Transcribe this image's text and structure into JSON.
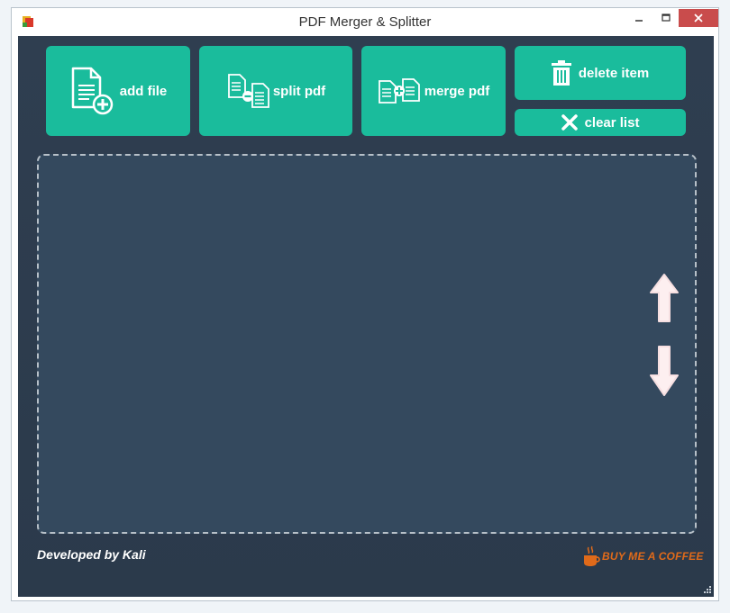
{
  "window": {
    "title": "PDF Merger & Splitter",
    "icons": {
      "app": "pdf-app-icon",
      "minimize": "minimize-icon",
      "maximize": "maximize-icon",
      "close": "close-icon"
    }
  },
  "toolbar": {
    "add_file": {
      "label": "add file",
      "icon": "file-add-icon"
    },
    "split_pdf": {
      "label": "split pdf",
      "icon": "split-files-icon"
    },
    "merge_pdf": {
      "label": "merge pdf",
      "icon": "merge-files-icon"
    },
    "delete_item": {
      "label": "delete item",
      "icon": "trash-icon"
    },
    "clear_list": {
      "label": "clear list",
      "icon": "x-cross-icon"
    }
  },
  "list": {
    "items": [],
    "move_up_icon": "arrow-up-icon",
    "move_down_icon": "arrow-down-icon"
  },
  "footer": {
    "credit": "Developed by Kali",
    "coffee_label": "BUY ME A COFFEE",
    "coffee_icon": "coffee-cup-icon"
  },
  "colors": {
    "accent": "#1abc9c",
    "background": "#2c3e50",
    "list_bg": "#34495e",
    "close_red": "#c94c4c",
    "coffee_orange": "#e06a1a"
  }
}
